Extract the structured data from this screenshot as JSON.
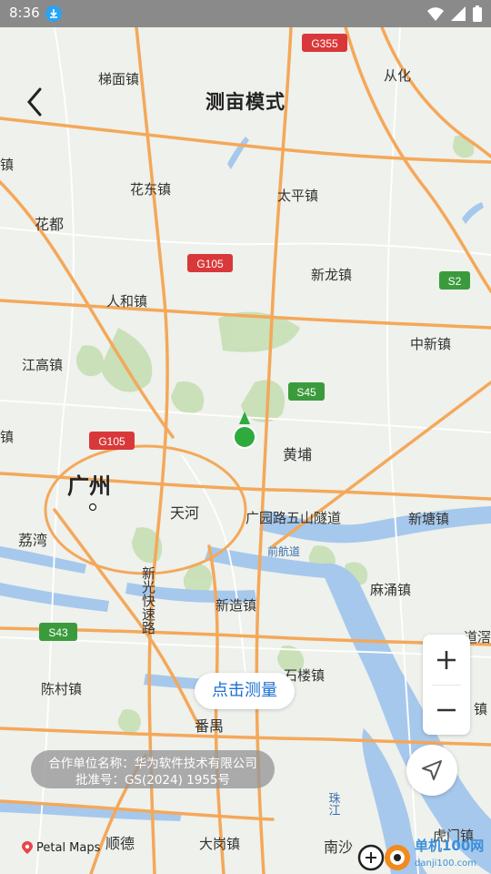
{
  "status_bar": {
    "time": "8:36",
    "download_icon": "download-icon",
    "icons": [
      "wifi-icon",
      "signal-icon",
      "battery-icon"
    ]
  },
  "header": {
    "title": "测亩模式",
    "back_icon": "chevron-left-icon"
  },
  "map": {
    "markers": [
      {
        "id": "location",
        "color": "#2eab3c"
      }
    ],
    "places": [
      {
        "name": "梯面镇"
      },
      {
        "name": "从化"
      },
      {
        "name": "花东镇"
      },
      {
        "name": "太平镇"
      },
      {
        "name": "花都"
      },
      {
        "name": "新龙镇"
      },
      {
        "name": "人和镇"
      },
      {
        "name": "中新镇"
      },
      {
        "name": "江高镇"
      },
      {
        "name": "黄埔"
      },
      {
        "name": "镇"
      },
      {
        "name": "广州"
      },
      {
        "name": "天河"
      },
      {
        "name": "广园路五山隧道"
      },
      {
        "name": "新塘镇"
      },
      {
        "name": "荔湾"
      },
      {
        "name": "前航道"
      },
      {
        "name": "新光快速路"
      },
      {
        "name": "麻涌镇"
      },
      {
        "name": "新造镇"
      },
      {
        "name": "石楼镇"
      },
      {
        "name": "陈村镇"
      },
      {
        "name": "番禺"
      },
      {
        "name": "珠江"
      },
      {
        "name": "顺德"
      },
      {
        "name": "大岗镇"
      },
      {
        "name": "南沙"
      },
      {
        "name": "虎门镇"
      },
      {
        "name": "道滘"
      },
      {
        "name": "镇"
      },
      {
        "name": "镇"
      }
    ],
    "road_shields": [
      {
        "label": "G355",
        "color": "#d9383a"
      },
      {
        "label": "G105",
        "color": "#d9383a"
      },
      {
        "label": "G105",
        "color": "#d9383a"
      },
      {
        "label": "S2",
        "color": "#3b9b3c"
      },
      {
        "label": "S45",
        "color": "#3b9b3c"
      },
      {
        "label": "S43",
        "color": "#3b9b3c"
      }
    ],
    "colors": {
      "land": "#eef1ec",
      "water": "#a6c8ec",
      "highway": "#f4a85a",
      "road": "#ffffff",
      "green": "#c5dfb4"
    }
  },
  "controls": {
    "measure_label": "点击测量",
    "zoom_in_icon": "plus-icon",
    "zoom_out_icon": "minus-icon",
    "locate_icon": "navigation-arrow-icon"
  },
  "credits": {
    "line1": "合作单位名称：华为软件技术有限公司",
    "line2": "批准号：GS(2024) 1955号"
  },
  "logo": {
    "text": "Petal Maps",
    "icon": "pin-icon"
  },
  "watermark": {
    "text": "单机100网",
    "url": "danji100.com"
  },
  "accent_color": "#1e6fd1"
}
